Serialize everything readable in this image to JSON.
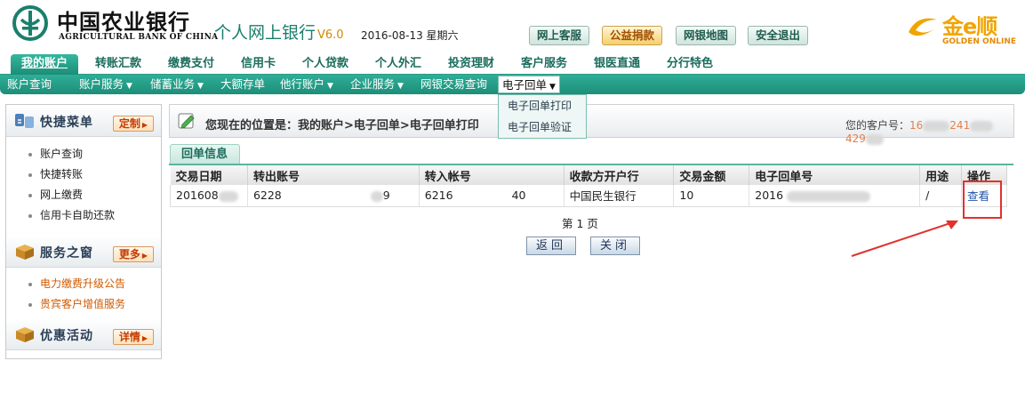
{
  "header": {
    "bank_name_cn": "中国农业银行",
    "bank_name_en": "AGRICULTURAL BANK OF CHINA",
    "site_title": "个人网上银行",
    "version": "V6.0",
    "date": "2016-08-13 星期六",
    "buttons": [
      "网上客服",
      "公益捐款",
      "网银地图",
      "安全退出"
    ],
    "partner_logo_cn": "金e顺",
    "partner_logo_en": "GOLDEN ONLINE"
  },
  "main_nav": [
    "我的账户",
    "转账汇款",
    "缴费支付",
    "信用卡",
    "个人贷款",
    "个人外汇",
    "投资理财",
    "客户服务",
    "银医直通",
    "分行特色"
  ],
  "sub_nav": [
    "账户查询",
    "账户服务",
    "储蓄业务",
    "大额存单",
    "他行账户",
    "企业服务",
    "网银交易查询",
    "电子回单"
  ],
  "dropdown": [
    "电子回单打印",
    "电子回单验证"
  ],
  "sidebar": {
    "quick_menu": {
      "title": "快捷菜单",
      "button": "定制",
      "links": [
        "账户查询",
        "快捷转账",
        "网上缴费",
        "信用卡自助还款"
      ]
    },
    "service_window": {
      "title": "服务之窗",
      "button": "更多",
      "links": [
        "电力缴费升级公告",
        "贵宾客户增值服务"
      ]
    },
    "promotions": {
      "title": "优惠活动",
      "button": "详情"
    }
  },
  "content": {
    "breadcrumb": "您现在的位置是：我的账户>电子回单>电子回单打印",
    "customer_label": "您的客户号：",
    "customer_no_head": "16",
    "customer_no_mid": "241",
    "customer_no_tail": "429",
    "section_tab": "回单信息",
    "table": {
      "headers": [
        "交易日期",
        "转出账号",
        "转入帐号",
        "收款方开户行",
        "交易金额",
        "电子回单号",
        "用途",
        "操作"
      ],
      "row": {
        "date": "201608",
        "from_acct_head": "6228",
        "from_acct_tail": "9",
        "to_acct_head": "6216",
        "to_acct_tail": "40",
        "bank": "中国民生银行",
        "amount": "10",
        "receipt_no": "2016",
        "purpose": "/",
        "action": "查看"
      }
    },
    "page_label": "第 1 页",
    "back_button": "返回",
    "close_button": "关闭"
  },
  "colors": {
    "brand_teal": "#1c8d78",
    "highlight_red": "#e0332c",
    "accent_orange": "#d05a00"
  }
}
